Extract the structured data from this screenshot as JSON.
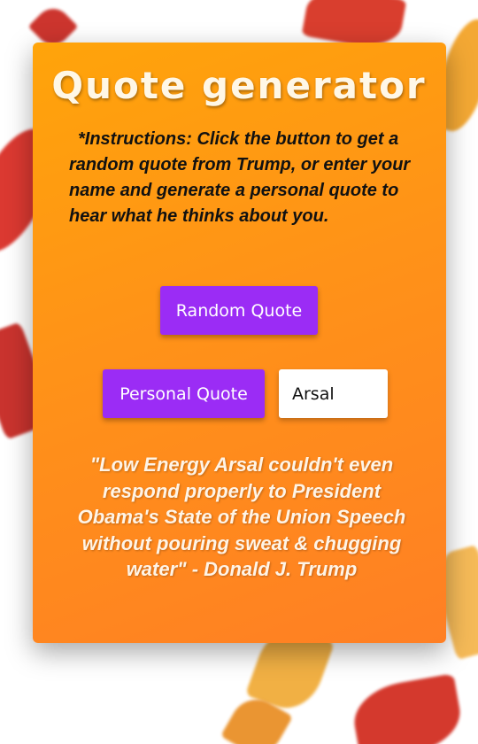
{
  "app": {
    "title": "Quote generator",
    "instructions": "*Instructions: Click the button to get a random quote from Trump, or enter your name and generate a personal quote to hear what he thinks about you."
  },
  "buttons": {
    "random_label": "Random Quote",
    "personal_label": "Personal Quote"
  },
  "name_input": {
    "value": "Arsal"
  },
  "quote": {
    "text": "\"Low Energy Arsal couldn't even respond properly to President Obama's State of the Union Speech without pouring sweat & chugging water\" - Donald J. Trump"
  },
  "colors": {
    "card_gradient_start": "#ffa40a",
    "card_gradient_end": "#ff7f24",
    "button": "#9b2cf5",
    "title_text": "#fff7e6"
  }
}
